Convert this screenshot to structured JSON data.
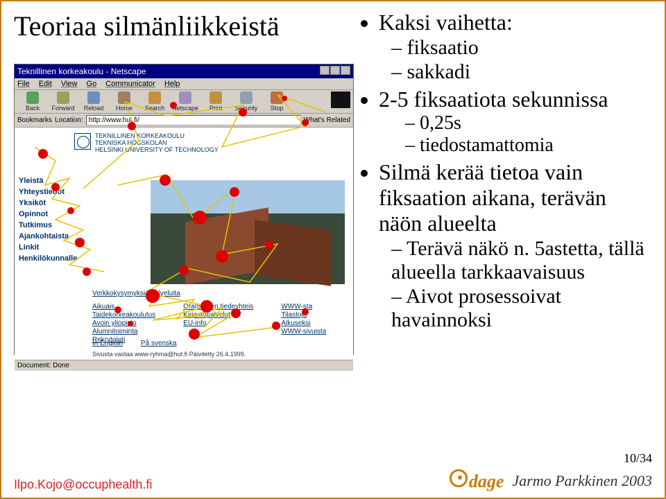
{
  "slide": {
    "title": "Teoriaa silmänliikkeistä",
    "page_number": "10/34"
  },
  "bullets": {
    "b0": "Kaksi vaihetta:",
    "b0_sub": [
      "fiksaatio",
      "sakkadi"
    ],
    "b1": "2-5 fiksaatiota sekunnissa",
    "b1_sub": [
      "0,25s",
      "tiedostamattomia"
    ],
    "b2": "Silmä kerää tietoa vain fiksaation aikana, terävän näön alueelta",
    "b2_sub": [
      "Terävä näkö n. 5astetta, tällä alueella tarkkaavaisuus",
      "Aivot prosessoivat havainnoksi"
    ]
  },
  "browser": {
    "title": "Teknillinen korkeakoulu - Netscape",
    "menu": [
      "File",
      "Edit",
      "View",
      "Go",
      "Communicator",
      "Help"
    ],
    "toolbar": [
      "Back",
      "Forward",
      "Reload",
      "Home",
      "Search",
      "Netscape",
      "Print",
      "Security",
      "Stop"
    ],
    "bookmarks_label": "Bookmarks",
    "location_label": "Location:",
    "location_value": "http://www.hut.fi/",
    "related_label": "What's Related",
    "logo_lines": [
      "TEKNILLINEN KORKEAKOULU",
      "TEKNISKA HÖGSKOLAN",
      "HELSINKI UNIVERSITY OF TECHNOLOGY"
    ],
    "sidebar_items": [
      "Yleistä",
      "Yhteystiedot",
      "Yksiköt",
      "Opinnot",
      "Tutkimus",
      "Ajankohtaista",
      "Linkit",
      "Henkilökunnalle"
    ],
    "body_head": "Verkkokysymyksiä palveluita",
    "body_col1": [
      "Aikuais",
      "Taidekorkeakoulutus",
      "Avoin yliopisto",
      "Alumnitoiminta",
      "Rekrytointi"
    ],
    "body_col2": [
      "Oranssisen tiedeyhteis",
      "Kirjastopalvelut",
      "EU-info"
    ],
    "body_col3": [
      "WWW-sta",
      "Tilastoja",
      "Alkuseksi",
      "WWW-sivuista"
    ],
    "lang": [
      "In English",
      "På svenska"
    ],
    "updated": "Sivusta vastaa www-ryhma@hut.fi  Päivitetty 26.4.1999.",
    "status": "Document: Done"
  },
  "footer": {
    "email": "Ilpo.Kojo@occuphealth.fi",
    "brand": "dage",
    "credit": "Jarmo Parkkinen 2003"
  }
}
